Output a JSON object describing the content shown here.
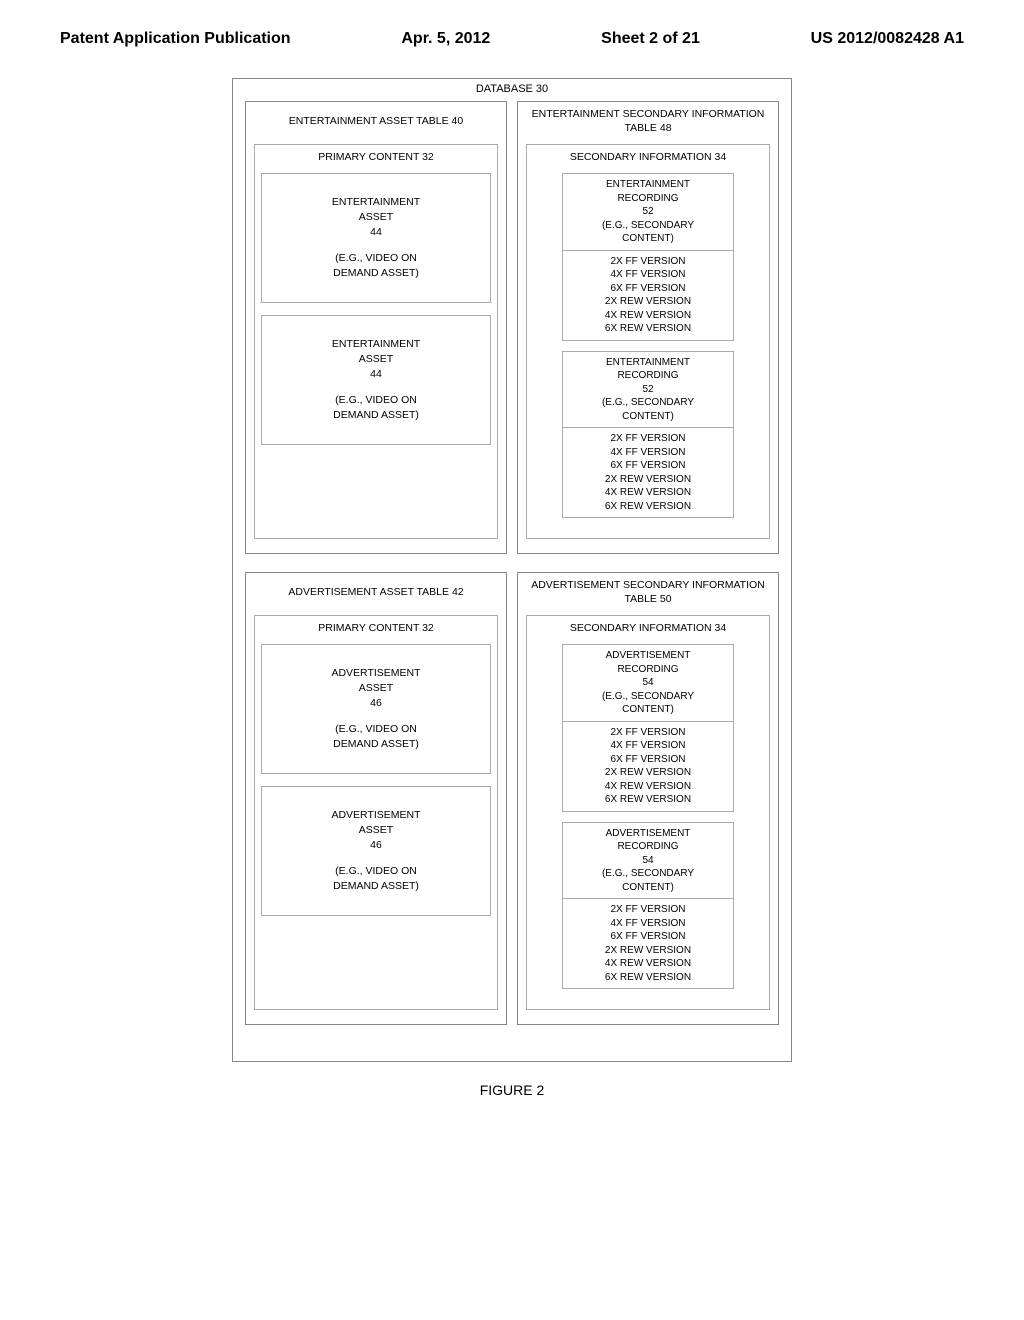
{
  "header": {
    "pub_type": "Patent Application Publication",
    "date": "Apr. 5, 2012",
    "sheet": "Sheet 2 of 21",
    "pub_number": "US 2012/0082428 A1"
  },
  "database_label": "DATABASE 30",
  "tables": {
    "entertainment_asset": {
      "title": "ENTERTAINMENT ASSET TABLE 40",
      "content_title": "PRIMARY CONTENT 32",
      "assets": [
        {
          "line1": "ENTERTAINMENT",
          "line2": "ASSET",
          "ref": "44",
          "eg1": "(E.G., VIDEO ON",
          "eg2": "DEMAND ASSET)"
        },
        {
          "line1": "ENTERTAINMENT",
          "line2": "ASSET",
          "ref": "44",
          "eg1": "(E.G., VIDEO ON",
          "eg2": "DEMAND ASSET)"
        }
      ]
    },
    "entertainment_secondary": {
      "title": "ENTERTAINMENT SECONDARY INFORMATION TABLE 48",
      "content_title": "SECONDARY INFORMATION 34",
      "recordings": [
        {
          "line1": "ENTERTAINMENT",
          "line2": "RECORDING",
          "ref": "52",
          "eg1": "(E.G., SECONDARY",
          "eg2": "CONTENT)",
          "versions": [
            "2X FF VERSION",
            "4X FF VERSION",
            "6X FF VERSION",
            "2X REW VERSION",
            "4X REW VERSION",
            "6X REW VERSION"
          ]
        },
        {
          "line1": "ENTERTAINMENT",
          "line2": "RECORDING",
          "ref": "52",
          "eg1": "(E.G., SECONDARY",
          "eg2": "CONTENT)",
          "versions": [
            "2X FF VERSION",
            "4X FF VERSION",
            "6X FF VERSION",
            "2X REW VERSION",
            "4X REW VERSION",
            "6X REW VERSION"
          ]
        }
      ]
    },
    "advertisement_asset": {
      "title": "ADVERTISEMENT ASSET TABLE 42",
      "content_title": "PRIMARY CONTENT 32",
      "assets": [
        {
          "line1": "ADVERTISEMENT",
          "line2": "ASSET",
          "ref": "46",
          "eg1": "(E.G., VIDEO ON",
          "eg2": "DEMAND ASSET)"
        },
        {
          "line1": "ADVERTISEMENT",
          "line2": "ASSET",
          "ref": "46",
          "eg1": "(E.G., VIDEO ON",
          "eg2": "DEMAND ASSET)"
        }
      ]
    },
    "advertisement_secondary": {
      "title": "ADVERTISEMENT SECONDARY INFORMATION TABLE 50",
      "content_title": "SECONDARY INFORMATION 34",
      "recordings": [
        {
          "line1": "ADVERTISEMENT",
          "line2": "RECORDING",
          "ref": "54",
          "eg1": "(E.G., SECONDARY",
          "eg2": "CONTENT)",
          "versions": [
            "2X FF VERSION",
            "4X FF VERSION",
            "6X FF VERSION",
            "2X REW VERSION",
            "4X REW VERSION",
            "6X REW VERSION"
          ]
        },
        {
          "line1": "ADVERTISEMENT",
          "line2": "RECORDING",
          "ref": "54",
          "eg1": "(E.G., SECONDARY",
          "eg2": "CONTENT)",
          "versions": [
            "2X FF VERSION",
            "4X FF VERSION",
            "6X FF VERSION",
            "2X REW VERSION",
            "4X REW VERSION",
            "6X REW VERSION"
          ]
        }
      ]
    }
  },
  "figure_caption": "FIGURE 2"
}
